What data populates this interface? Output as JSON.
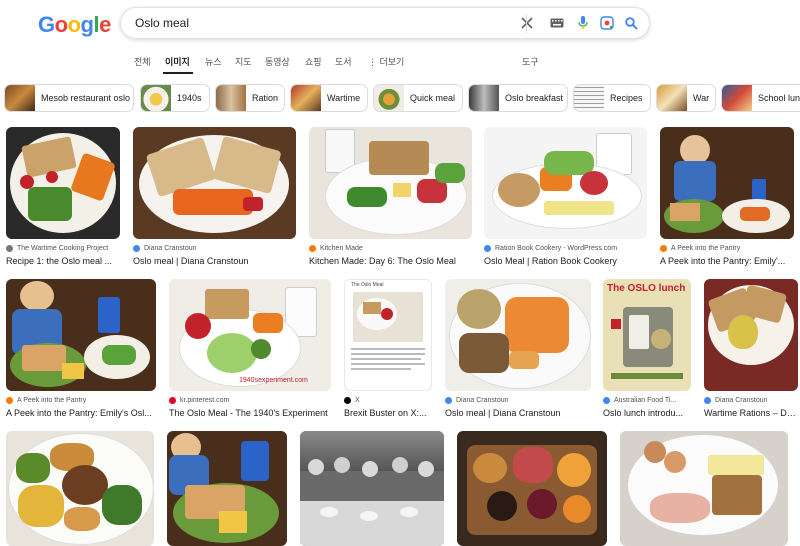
{
  "search": {
    "query": "Oslo meal"
  },
  "logo": "Google",
  "tabs": [
    "전체",
    "이미지",
    "뉴스",
    "지도",
    "동영상",
    "쇼핑",
    "도서",
    "⋮ 더보기",
    "도구"
  ],
  "chips": [
    "Mesob restaurant oslo",
    "1940s",
    "Ration",
    "Wartime",
    "Quick meal",
    "Oslo breakfast",
    "Recipes",
    "War",
    "School lunch"
  ],
  "results_row1": [
    {
      "source": "The Wartime Cooking Project",
      "title": "Recipe 1: the Oslo meal ..."
    },
    {
      "source": "Diana Cranstoun",
      "title": "Oslo meal | Diana Cranstoun"
    },
    {
      "source": "Kitchen Made",
      "title": "Kitchen Made: Day 6: The Oslo Meal"
    },
    {
      "source": "Ration Book Cookery - WordPress.com",
      "title": "Oslo Meal | Ration Book Cookery"
    },
    {
      "source": "A Peek into the Pantry",
      "title": "A Peek into the Pantry: Emily'..."
    }
  ],
  "results_row2": [
    {
      "source": "A Peek into the Pantry",
      "title": "A Peek into the Pantry: Emily's Osl..."
    },
    {
      "source": "kr.pinterest.com",
      "title": "The Oslo Meal - The 1940's Experiment"
    },
    {
      "source": "X",
      "title": "Brexit Buster on X:..."
    },
    {
      "source": "Diana Cranstoun",
      "title": "Oslo meal | Diana Cranstoun"
    },
    {
      "source": "Australian Food Ti...",
      "title": "Oslo lunch introdu..."
    },
    {
      "source": "Diana Cranstoun",
      "title": "Wartime Rations – Day..."
    }
  ],
  "image_text": {
    "oslo_lunch": "The OSLO lunch",
    "pinterest_watermark": "1940sexperiment.com",
    "x_card_heading": "The Oslo Meal"
  },
  "colors": {
    "google_blue": "#4285f4",
    "google_red": "#ea4335",
    "google_yellow": "#fbbc05",
    "google_green": "#34a853"
  }
}
